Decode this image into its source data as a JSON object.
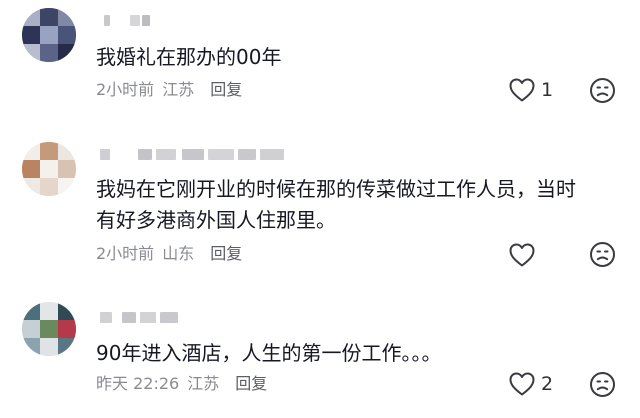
{
  "comments": [
    {
      "text_lines": [
        "我婚礼在那办的00年"
      ],
      "time": "2小时前",
      "location": "江苏",
      "reply_label": "回复",
      "likes": "1",
      "like_icon": "heart-outline-icon",
      "dislike_icon": "frown-face-icon"
    },
    {
      "text_lines": [
        "我妈在它刚开业的时候在那的传菜做过工作人员，当时",
        "有好多港商外国人住那里。"
      ],
      "time": "2小时前",
      "location": "山东",
      "reply_label": "回复",
      "likes": "",
      "like_icon": "heart-outline-icon",
      "dislike_icon": "frown-face-icon"
    },
    {
      "text_lines": [
        "90年进入酒店，人生的第一份工作。。。"
      ],
      "time": "昨天 22:26",
      "location": "江苏",
      "reply_label": "回复",
      "likes": "2",
      "like_icon": "heart-outline-icon",
      "dislike_icon": "frown-face-icon"
    }
  ],
  "colors": {
    "text": "#161823",
    "meta": "#8a8b91",
    "reply": "#5c5e66",
    "icon_stroke": "#3a3b40"
  }
}
